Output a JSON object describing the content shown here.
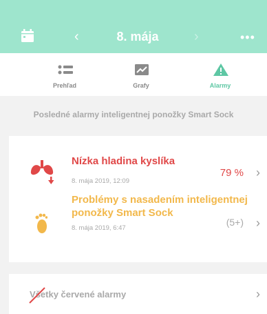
{
  "header": {
    "title": "8. mája",
    "prev_glyph": "‹",
    "next_glyph": "›",
    "more_glyph": "•••",
    "bg_color": "#9ee5cd"
  },
  "tabs": [
    {
      "label": "Prehľad",
      "icon": "list-icon",
      "active": false
    },
    {
      "label": "Grafy",
      "icon": "chart-icon",
      "active": false
    },
    {
      "label": "Alarmy",
      "icon": "warning-icon",
      "active": true
    }
  ],
  "subtitle": "Posledné alarmy inteligentnej ponožky Smart Sock",
  "alarms": [
    {
      "title": "Nízka hladina kyslíka",
      "date": "8. mája 2019, 12:09",
      "value": "79 %",
      "icon": "lungs-icon",
      "color": "#e04848"
    },
    {
      "title_line1": "Problémy s nasadením inteligentnej",
      "title_line2": "ponožky Smart Sock",
      "date": "8. mája 2019, 6:47",
      "value": "(5+)",
      "icon": "foot-icon",
      "color": "#f2b84b"
    }
  ],
  "chevron_glyph": "›",
  "all_red": {
    "label": "Všetky červené alarmy"
  }
}
